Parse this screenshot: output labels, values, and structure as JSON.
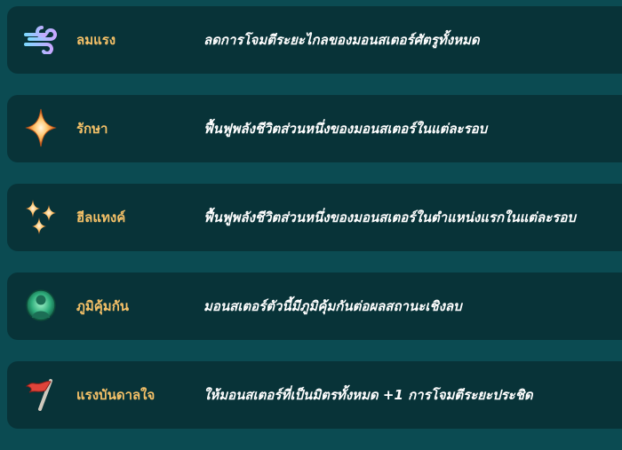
{
  "abilities": [
    {
      "name": "ลมแรง",
      "description": "ลดการโจมตีระยะไกลของมอนสเตอร์ศัตรูทั้งหมด",
      "icon": "wind-icon",
      "icon_color": "#b9a6ff"
    },
    {
      "name": "รักษา",
      "description": "ฟื้นฟูพลังชีวิตส่วนหนึ่งของมอนสเตอร์ในแต่ละรอบ",
      "icon": "heal-sparkle-icon",
      "icon_color": "#f7a24a"
    },
    {
      "name": "ฮีลแทงค์",
      "description": "ฟื้นฟูพลังชีวิตส่วนหนึ่งของมอนสเตอร์ในตำแหน่งแรกในแต่ละรอบ",
      "icon": "tank-heal-sparkles-icon",
      "icon_color": "#f7a24a"
    },
    {
      "name": "ภูมิคุ้มกัน",
      "description": "มอนสเตอร์ตัวนี้มีภูมิคุ้มกันต่อผลสถานะเชิงลบ",
      "icon": "immunity-figure-icon",
      "icon_color": "#3fbf8f"
    },
    {
      "name": "แรงบันดาลใจ",
      "description": "ให้มอนสเตอร์ที่เป็นมิตรทั้งหมด +1 การโจมตีระยะประชิด",
      "icon": "inspire-flag-icon",
      "icon_color": "#e0443a"
    }
  ]
}
